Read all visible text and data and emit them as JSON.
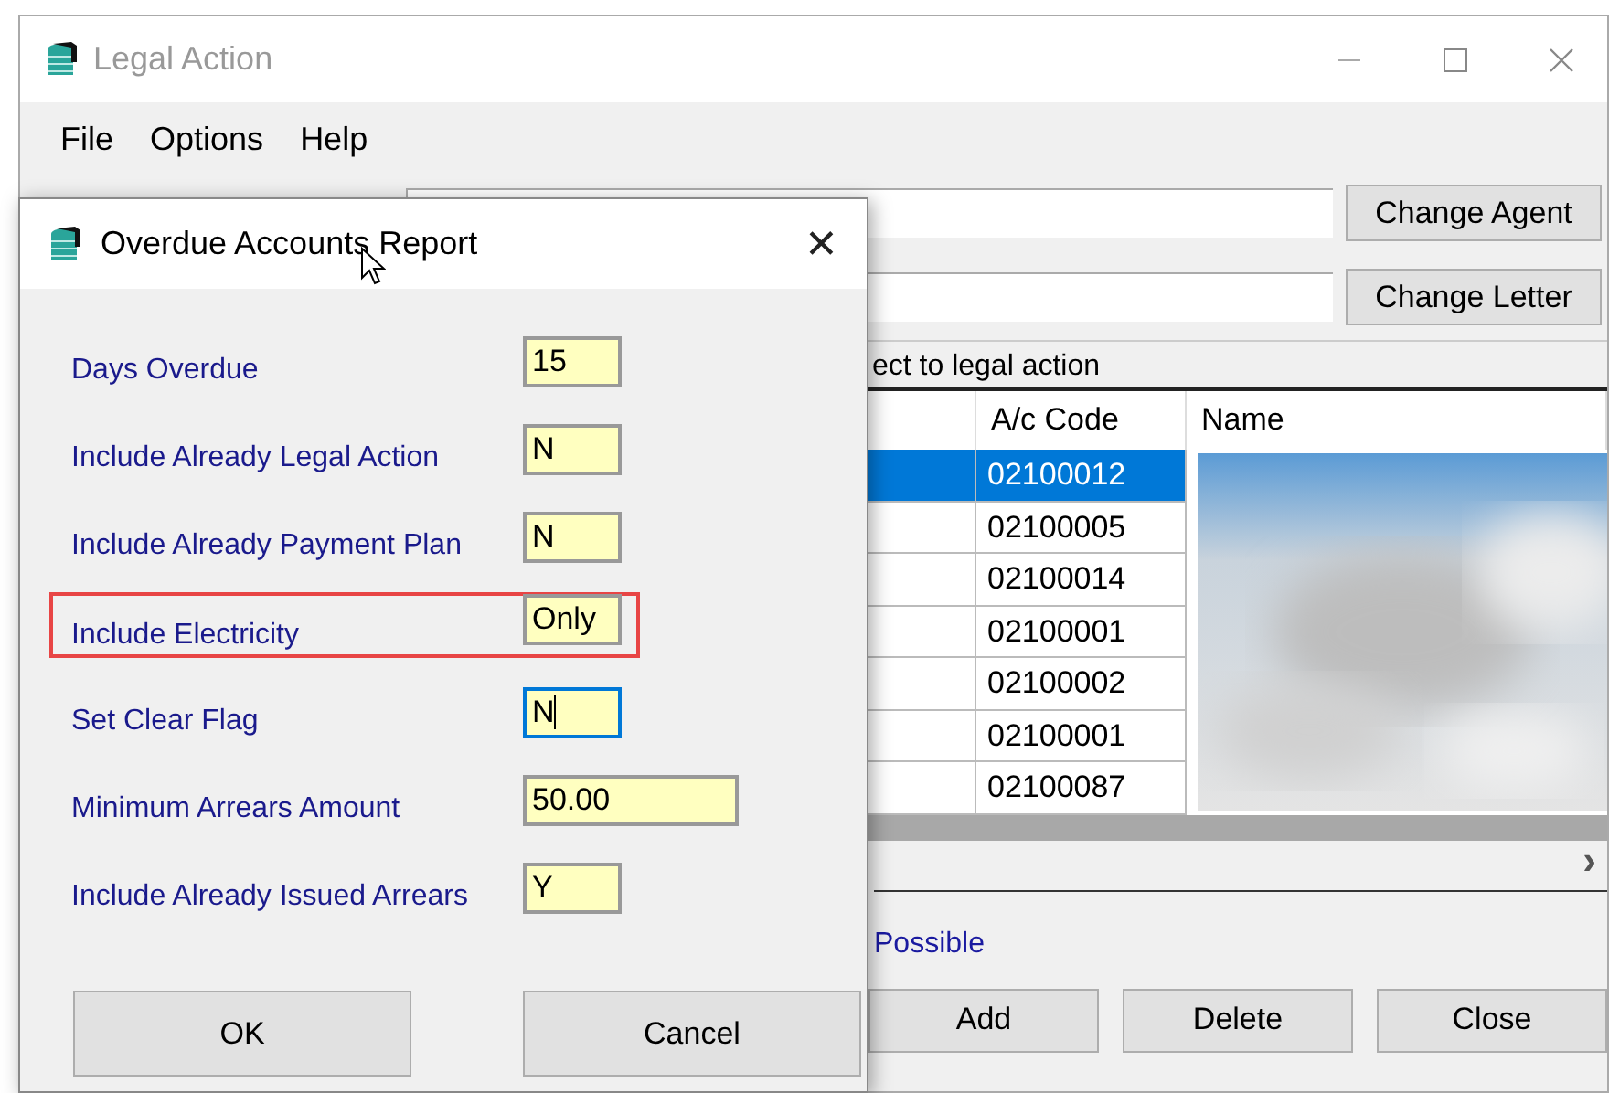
{
  "window": {
    "title": "Legal Action"
  },
  "menu": [
    {
      "label": "File"
    },
    {
      "label": "Options"
    },
    {
      "label": "Help"
    }
  ],
  "agent_buttons": [
    "Change Agent",
    "Change Letter"
  ],
  "group": {
    "title": "ect to legal action"
  },
  "table": {
    "columns": [
      "A/c Code",
      "Name"
    ],
    "rows": [
      {
        "code": "02100012",
        "selected": true
      },
      {
        "code": "02100005",
        "selected": false
      },
      {
        "code": "02100014",
        "selected": false
      },
      {
        "code": "02100001",
        "selected": false
      },
      {
        "code": "02100002",
        "selected": false
      },
      {
        "code": "02100001",
        "selected": false
      },
      {
        "code": "02100087",
        "selected": false
      }
    ]
  },
  "scroll_arrow": "›",
  "note": "Possible",
  "bottom_buttons": [
    "Add",
    "Delete",
    "Close"
  ],
  "dialog": {
    "title": "Overdue Accounts Report",
    "close": "✕",
    "fields": [
      {
        "label": "Days Overdue",
        "value": "15",
        "kind": "short",
        "focused": false,
        "highlighted": false
      },
      {
        "label": "Include Already Legal Action",
        "value": "N",
        "kind": "short",
        "focused": false,
        "highlighted": false
      },
      {
        "label": "Include Already Payment Plan",
        "value": "N",
        "kind": "short",
        "focused": false,
        "highlighted": false
      },
      {
        "label": "Include Electricity",
        "value": "Only",
        "kind": "short",
        "focused": false,
        "highlighted": true
      },
      {
        "label": "Set Clear Flag",
        "value": "N",
        "kind": "short",
        "focused": true,
        "highlighted": false
      },
      {
        "label": "Minimum Arrears Amount",
        "value": "50.00",
        "kind": "wide",
        "focused": false,
        "highlighted": false
      },
      {
        "label": "Include Already Issued Arrears",
        "value": "Y",
        "kind": "short",
        "focused": false,
        "highlighted": false
      }
    ],
    "buttons": [
      "OK",
      "Cancel"
    ]
  }
}
